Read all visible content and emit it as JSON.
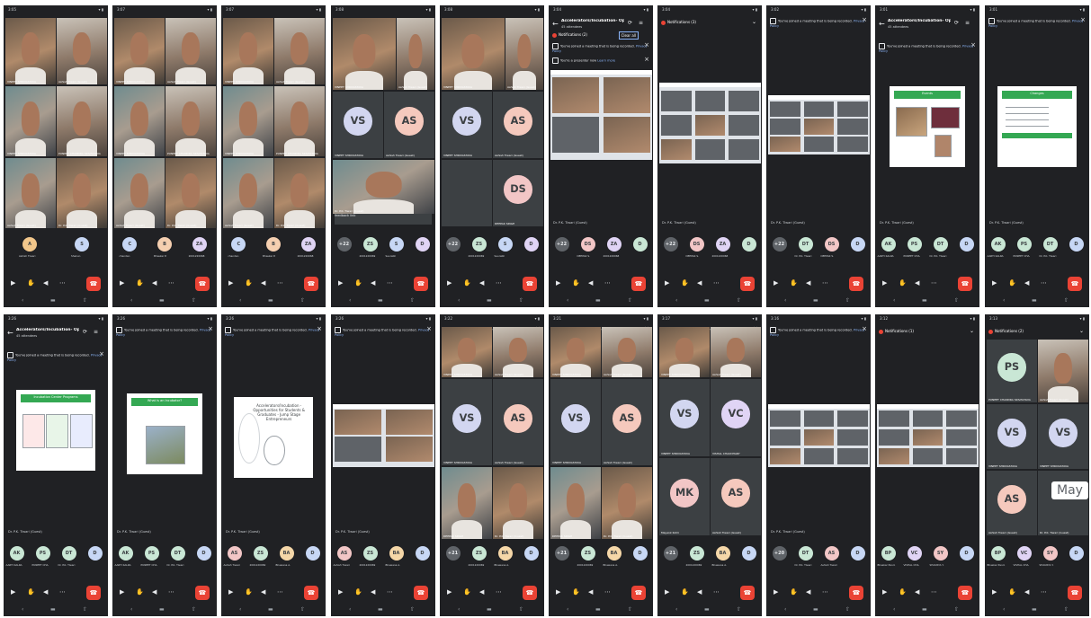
{
  "colors": {
    "phone_bg": "#202124",
    "tile_bg": "#3c4043",
    "end_call": "#ea4335",
    "link": "#8ab4f8",
    "slide_header": "#34a853"
  },
  "strings": {
    "meeting_title": "Accelerators/Incubation- Opport...",
    "attendees": "45 attendees",
    "recording_notice": "You've joined a meeting that is being recorded.",
    "privacy_policy": "Privacy Policy",
    "notifications_3": "Notifications (3)",
    "notifications_1": "Notifications (1)",
    "notifications_2": "Notifications (2)",
    "clear_all": "Clear all",
    "presenter_note": "You're a presenter now",
    "learn_more": "Learn more",
    "feedback_link": "feedback link",
    "presenting": "Dr. P.K. Tiwari (Guest)",
    "tooltip_may": "May",
    "slide_incubation": "Incubation Center Programs",
    "slide_what": "What is an Incubator?",
    "slide_events": "Events",
    "slide_changes": "Changes",
    "slide_accel": "Accelerators/Incubation - Opportunities for Students & Graduates - Jump Stage Entrepreneurs"
  },
  "names": {
    "vs": "VINEET SHRIVASTAVA",
    "as": "Ashish Tiwari (Guest)",
    "ds": "DEEPAK SINGH",
    "pk": "Dr. P.K. Tiwari (Guest)",
    "ps": "PUNEET CHANDRA SRIVASTAVA",
    "ak": "AARTI KALRA",
    "mk": "Mayank Kohli",
    "vc": "VISHAL CHAUDHARY",
    "sy": "SHAURYA Y.",
    "bp": "Bhaskar Pandey"
  },
  "status_times": [
    "3:05",
    "3:07",
    "3:07",
    "3:08",
    "3:08",
    "3:04",
    "3:04",
    "3:02",
    "3:01",
    "3:01",
    "3:26",
    "3:26",
    "3:26",
    "3:26",
    "3:22",
    "3:21",
    "3:17",
    "3:16",
    "3:12",
    "3:13"
  ],
  "phones": [
    {
      "layout": "video4",
      "top": {
        "time": "3:05"
      },
      "tray": [
        {
          "i": "A",
          "c": "#f2c78b",
          "l": "Ashish Tiwari"
        },
        {
          "i": "S",
          "c": "#c7d7f5",
          "l": "Shakun"
        }
      ]
    },
    {
      "layout": "video4",
      "tray": [
        {
          "i": "C",
          "c": "#c7d7f5",
          "l": "chandan"
        },
        {
          "i": "B",
          "c": "#f5cfb0",
          "l": "Bhaskar P."
        },
        {
          "i": "ZA",
          "c": "#e0d4f5",
          "l": "2001220068"
        }
      ]
    },
    {
      "layout": "video4",
      "tray": [
        {
          "i": "C",
          "c": "#c7d7f5",
          "l": "chandan"
        },
        {
          "i": "B",
          "c": "#f5cfb0",
          "l": "Bhaskar P."
        },
        {
          "i": "ZA",
          "c": "#e0d4f5",
          "l": "2001220068"
        }
      ]
    },
    {
      "layout": "vs_as_video",
      "tray": [
        {
          "i": "+22",
          "c": "#5f6368",
          "l": ""
        },
        {
          "i": "ZS",
          "c": "#c9e7d5",
          "l": "2001220069"
        },
        {
          "i": "S",
          "c": "#c7d7f5",
          "l": "Saurabh"
        },
        {
          "i": "D",
          "c": "#e0d4f5",
          "l": ""
        }
      ]
    },
    {
      "layout": "vs_as_ds",
      "tray": [
        {
          "i": "+22",
          "c": "#5f6368",
          "l": ""
        },
        {
          "i": "ZS",
          "c": "#c9e7d5",
          "l": "2001220069"
        },
        {
          "i": "S",
          "c": "#c7d7f5",
          "l": "Saurabh"
        },
        {
          "i": "D",
          "c": "#e0d4f5",
          "l": ""
        }
      ]
    },
    {
      "layout": "notif_share",
      "tray": [
        {
          "i": "+22",
          "c": "#5f6368",
          "l": ""
        },
        {
          "i": "DS",
          "c": "#f2c6c6",
          "l": "DEEPAK S."
        },
        {
          "i": "ZA",
          "c": "#e0d4f5",
          "l": "2001220068"
        },
        {
          "i": "D",
          "c": "#c9e7d5",
          "l": ""
        }
      ]
    },
    {
      "layout": "notif3_share",
      "tray": [
        {
          "i": "+22",
          "c": "#5f6368",
          "l": ""
        },
        {
          "i": "DS",
          "c": "#f2c6c6",
          "l": "DEEPAK S."
        },
        {
          "i": "ZA",
          "c": "#e0d4f5",
          "l": "2001220068"
        },
        {
          "i": "D",
          "c": "#c9e7d5",
          "l": ""
        }
      ]
    },
    {
      "layout": "share_grid",
      "tray": [
        {
          "i": "+22",
          "c": "#5f6368",
          "l": ""
        },
        {
          "i": "DT",
          "c": "#c9e7d5",
          "l": "Dr. P.K. Tiwari"
        },
        {
          "i": "DS",
          "c": "#f2c6c6",
          "l": "DEEPAK S."
        },
        {
          "i": "D",
          "c": "#c7d7f5",
          "l": ""
        }
      ]
    },
    {
      "layout": "slide_events",
      "tray": [
        {
          "i": "AK",
          "c": "#c9e7d5",
          "l": "AARTI KALRA"
        },
        {
          "i": "PS",
          "c": "#c9e7d5",
          "l": "PUNEET CHA."
        },
        {
          "i": "DT",
          "c": "#c9e7d5",
          "l": "Dr. P.K. Tiwari"
        },
        {
          "i": "D",
          "c": "#c7d7f5",
          "l": ""
        }
      ]
    },
    {
      "layout": "slide_changes",
      "tray": [
        {
          "i": "AK",
          "c": "#c9e7d5",
          "l": "AARTI KALRA"
        },
        {
          "i": "PS",
          "c": "#c9e7d5",
          "l": "PUNEET CHA."
        },
        {
          "i": "DT",
          "c": "#c9e7d5",
          "l": "Dr. P.K. Tiwari"
        },
        {
          "i": "D",
          "c": "#c7d7f5",
          "l": ""
        }
      ]
    },
    {
      "layout": "slide_incubation",
      "tray": [
        {
          "i": "AK",
          "c": "#c9e7d5",
          "l": "AARTI KALRA"
        },
        {
          "i": "PS",
          "c": "#c9e7d5",
          "l": "PUNEET CHA."
        },
        {
          "i": "DT",
          "c": "#c9e7d5",
          "l": "Dr. P.K. Tiwari"
        },
        {
          "i": "D",
          "c": "#c7d7f5",
          "l": ""
        }
      ]
    },
    {
      "layout": "slide_what",
      "tray": [
        {
          "i": "AK",
          "c": "#c9e7d5",
          "l": "AARTI KALRA"
        },
        {
          "i": "PS",
          "c": "#c9e7d5",
          "l": "PUNEET CHA."
        },
        {
          "i": "DT",
          "c": "#c9e7d5",
          "l": "Dr. P.K. Tiwari"
        },
        {
          "i": "D",
          "c": "#c7d7f5",
          "l": ""
        }
      ]
    },
    {
      "layout": "slide_accel",
      "tray": [
        {
          "i": "AS",
          "c": "#f2c6c6",
          "l": "Ashish Tiwari"
        },
        {
          "i": "ZS",
          "c": "#c9e7d5",
          "l": "2001220069"
        },
        {
          "i": "BA",
          "c": "#f5d7a8",
          "l": "Bhawana A."
        },
        {
          "i": "D",
          "c": "#c7d7f5",
          "l": ""
        }
      ]
    },
    {
      "layout": "share_video",
      "tray": [
        {
          "i": "AS",
          "c": "#f2c6c6",
          "l": "Ashish Tiwari"
        },
        {
          "i": "ZS",
          "c": "#c9e7d5",
          "l": "2001220069"
        },
        {
          "i": "BA",
          "c": "#f5d7a8",
          "l": "Bhawana A."
        },
        {
          "i": "D",
          "c": "#c7d7f5",
          "l": ""
        }
      ]
    },
    {
      "layout": "video_vs_as_video",
      "tray": [
        {
          "i": "+21",
          "c": "#5f6368",
          "l": ""
        },
        {
          "i": "ZS",
          "c": "#c9e7d5",
          "l": "2001220069"
        },
        {
          "i": "BA",
          "c": "#f5d7a8",
          "l": "Bhawana A."
        },
        {
          "i": "D",
          "c": "#c7d7f5",
          "l": ""
        }
      ]
    },
    {
      "layout": "video_vs_as_video",
      "tray": [
        {
          "i": "+21",
          "c": "#5f6368",
          "l": ""
        },
        {
          "i": "ZS",
          "c": "#c9e7d5",
          "l": "2001220069"
        },
        {
          "i": "BA",
          "c": "#f5d7a8",
          "l": "Bhawana A."
        },
        {
          "i": "D",
          "c": "#c7d7f5",
          "l": ""
        }
      ]
    },
    {
      "layout": "video_vs_vc_mk_as",
      "tray": [
        {
          "i": "+21",
          "c": "#5f6368",
          "l": ""
        },
        {
          "i": "ZS",
          "c": "#c9e7d5",
          "l": "2001220069"
        },
        {
          "i": "BA",
          "c": "#f5d7a8",
          "l": "Bhawana A."
        },
        {
          "i": "D",
          "c": "#c7d7f5",
          "l": ""
        }
      ]
    },
    {
      "layout": "share_grid2",
      "tray": [
        {
          "i": "+20",
          "c": "#5f6368",
          "l": ""
        },
        {
          "i": "DT",
          "c": "#c9e7d5",
          "l": "Dr. P.K. Tiwari"
        },
        {
          "i": "AS",
          "c": "#f2c6c6",
          "l": "Ashish Tiwari"
        },
        {
          "i": "D",
          "c": "#c7d7f5",
          "l": ""
        }
      ]
    },
    {
      "layout": "notif1_share",
      "tray": [
        {
          "i": "BP",
          "c": "#c9e7d5",
          "l": "Bhaskar Pand."
        },
        {
          "i": "VC",
          "c": "#e0d4f5",
          "l": "VISHAL CHA."
        },
        {
          "i": "SY",
          "c": "#f2c6c6",
          "l": "SHAURYA Y."
        },
        {
          "i": "D",
          "c": "#c7d7f5",
          "l": ""
        }
      ]
    },
    {
      "layout": "notif2_ps_vs_as",
      "tray": [
        {
          "i": "BP",
          "c": "#c9e7d5",
          "l": "Bhaskar Pand."
        },
        {
          "i": "VC",
          "c": "#e0d4f5",
          "l": "VISHAL CHA."
        },
        {
          "i": "SY",
          "c": "#f2c6c6",
          "l": "SHAURYA Y."
        },
        {
          "i": "D",
          "c": "#c7d7f5",
          "l": ""
        }
      ]
    }
  ]
}
